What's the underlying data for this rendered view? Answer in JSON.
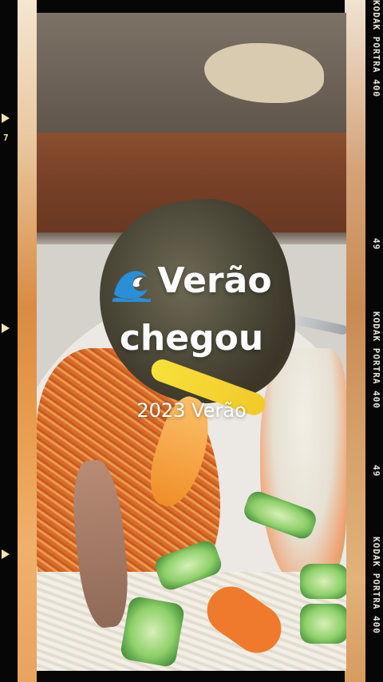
{
  "overlay": {
    "title_line1": "Verão",
    "title_line2": "chegou",
    "subtitle": "2023 Verão",
    "title_icon": "water-wave-icon"
  },
  "film_edge": {
    "right_labels": [
      "KODAK PORTRA 400",
      "49",
      "KODAK PORTRA 400",
      "49",
      "KODAK PORTRA 400"
    ],
    "left_frame_number": "7"
  },
  "colors": {
    "film_frame": "#060606",
    "edge_text": "#e9e5db",
    "title_text": "#ffffff",
    "wave_blue": "#2a8fd6"
  }
}
